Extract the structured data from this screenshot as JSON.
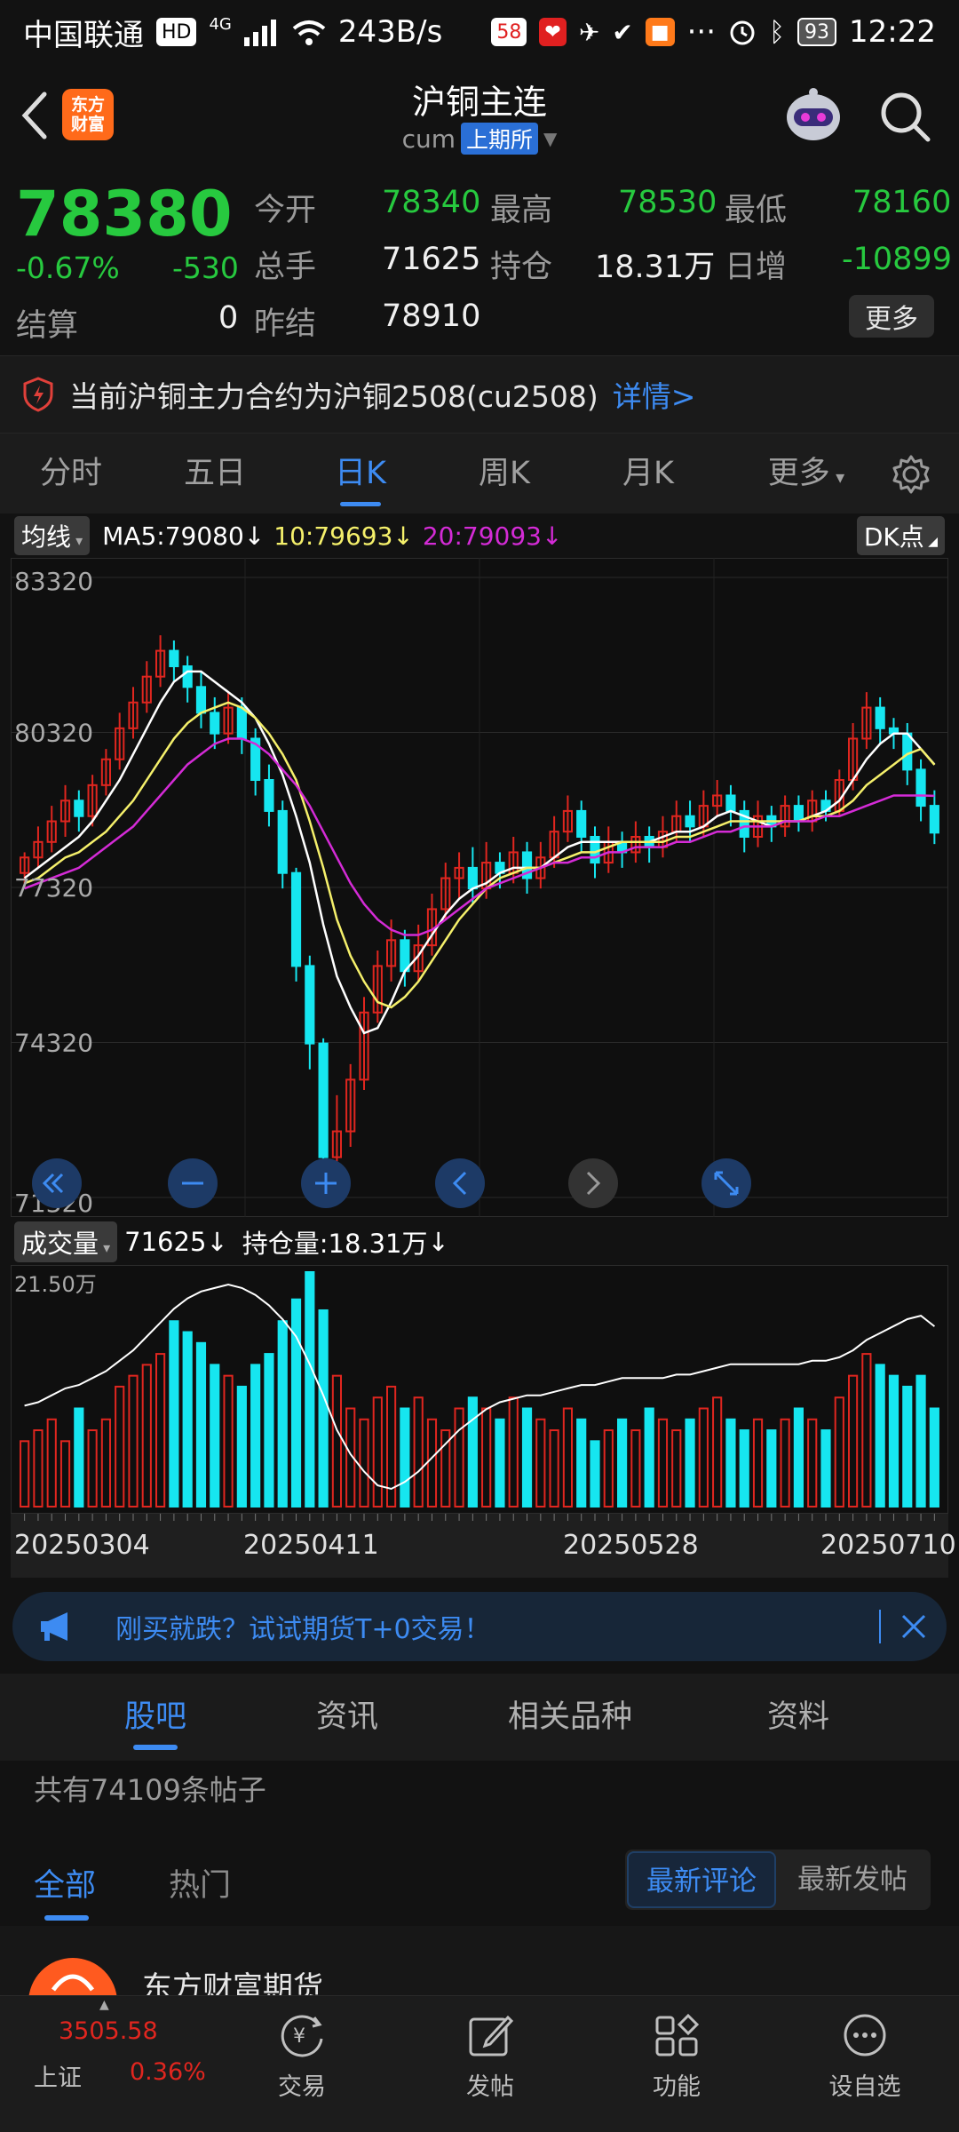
{
  "status_bar": {
    "carrier": "中国联通",
    "hd": "HD",
    "network": "4G",
    "speed": "243B/s",
    "app_badges": [
      "58"
    ],
    "battery": "93",
    "time": "12:22",
    "more": "···"
  },
  "header": {
    "logo_text": "东方\n财富",
    "title": "沪铜主连",
    "code": "cum",
    "exchange": "上期所"
  },
  "quote": {
    "price": "78380",
    "change_pct": "-0.67%",
    "change": "-530",
    "open_label": "今开",
    "open": "78340",
    "high_label": "最高",
    "high": "78530",
    "low_label": "最低",
    "low": "78160",
    "volume_label": "总手",
    "volume": "71625",
    "oi_label": "持仓",
    "oi": "18.31万",
    "daily_inc_label": "日增",
    "daily_inc": "-10899",
    "settle_label": "结算",
    "settle": "0",
    "prev_settle_label": "昨结",
    "prev_settle": "78910",
    "more_label": "更多"
  },
  "notice": {
    "text": "当前沪铜主力合约为沪铜2508(cu2508)",
    "link": "详情>"
  },
  "period_tabs": [
    "分时",
    "五日",
    "日K",
    "周K",
    "月K",
    "更多"
  ],
  "active_period": "日K",
  "ma_legend": {
    "selector": "均线",
    "ma5": "MA5:79080",
    "ma10": "10:79693",
    "ma20": "20:79093",
    "arrow": "↓",
    "dk": "DK点"
  },
  "colors": {
    "up": "#e0261f",
    "down": "#16e6f0",
    "ma5": "#ffffff",
    "ma10": "#f5f06b",
    "ma20": "#d42bd6",
    "accent": "#3d8bf2",
    "price_down": "#27c93f"
  },
  "volume_legend": {
    "selector": "成交量",
    "volume": "71625",
    "oi": "持仓量:18.31万",
    "arrow": "↓",
    "axis_max": "21.50万"
  },
  "chart_data": {
    "type": "candlestick",
    "ylim": [
      71320,
      83320
    ],
    "y_ticks": [
      "83320",
      "80320",
      "77320",
      "74320",
      "71320"
    ],
    "x_labels": [
      "20250304",
      "20250411",
      "20250528",
      "20250710"
    ],
    "candles": [
      [
        77600,
        77900,
        77300,
        78000
      ],
      [
        77900,
        78200,
        77700,
        78500
      ],
      [
        78200,
        78600,
        78000,
        78900
      ],
      [
        78600,
        79000,
        78300,
        79300
      ],
      [
        79000,
        78700,
        78400,
        79200
      ],
      [
        78700,
        79300,
        78500,
        79500
      ],
      [
        79300,
        79800,
        79100,
        80000
      ],
      [
        79800,
        80400,
        79600,
        80700
      ],
      [
        80400,
        80900,
        80200,
        81200
      ],
      [
        80900,
        81400,
        80700,
        81700
      ],
      [
        81400,
        81900,
        81200,
        82200
      ],
      [
        81900,
        81600,
        81300,
        82100
      ],
      [
        81600,
        81200,
        80900,
        81800
      ],
      [
        81200,
        80700,
        80400,
        81500
      ],
      [
        80700,
        80300,
        80000,
        81000
      ],
      [
        80300,
        80800,
        80100,
        81100
      ],
      [
        80800,
        80200,
        79900,
        81000
      ],
      [
        80200,
        79400,
        79100,
        80400
      ],
      [
        79400,
        78800,
        78500,
        79700
      ],
      [
        78800,
        77600,
        77300,
        79000
      ],
      [
        77600,
        75800,
        75500,
        77700
      ],
      [
        75800,
        74300,
        73800,
        76000
      ],
      [
        74300,
        72100,
        71400,
        74400
      ],
      [
        72100,
        72600,
        71500,
        73300
      ],
      [
        72600,
        73600,
        72300,
        73900
      ],
      [
        73600,
        74900,
        73400,
        75200
      ],
      [
        74900,
        75800,
        74700,
        76100
      ],
      [
        75800,
        76300,
        75500,
        76700
      ],
      [
        76300,
        75700,
        75400,
        76500
      ],
      [
        75700,
        76200,
        75500,
        76600
      ],
      [
        76200,
        76900,
        76000,
        77200
      ],
      [
        76900,
        77500,
        76700,
        77800
      ],
      [
        77500,
        77700,
        77100,
        78000
      ],
      [
        77700,
        77300,
        77000,
        78100
      ],
      [
        77300,
        77800,
        77100,
        78200
      ],
      [
        77800,
        77600,
        77300,
        78000
      ],
      [
        77600,
        78000,
        77400,
        78300
      ],
      [
        78000,
        77500,
        77200,
        78200
      ],
      [
        77500,
        77900,
        77300,
        78200
      ],
      [
        77900,
        78400,
        77700,
        78700
      ],
      [
        78400,
        78800,
        78200,
        79100
      ],
      [
        78800,
        78300,
        78000,
        79000
      ],
      [
        78300,
        77800,
        77500,
        78500
      ],
      [
        77800,
        78200,
        77600,
        78500
      ],
      [
        78200,
        78000,
        77700,
        78400
      ],
      [
        78000,
        78300,
        77800,
        78600
      ],
      [
        78300,
        78100,
        77800,
        78500
      ],
      [
        78100,
        78400,
        77900,
        78700
      ],
      [
        78400,
        78700,
        78200,
        79000
      ],
      [
        78700,
        78500,
        78200,
        79000
      ],
      [
        78500,
        78900,
        78300,
        79200
      ],
      [
        78900,
        79100,
        78700,
        79400
      ],
      [
        79100,
        78800,
        78500,
        79300
      ],
      [
        78800,
        78300,
        78000,
        79000
      ],
      [
        78300,
        78700,
        78100,
        79000
      ],
      [
        78700,
        78500,
        78200,
        78900
      ],
      [
        78500,
        78900,
        78300,
        79100
      ],
      [
        78900,
        78600,
        78400,
        79100
      ],
      [
        78600,
        79000,
        78400,
        79200
      ],
      [
        79000,
        78800,
        78600,
        79200
      ],
      [
        78800,
        79400,
        78700,
        79600
      ],
      [
        79400,
        80200,
        79200,
        80500
      ],
      [
        80200,
        80800,
        80000,
        81100
      ],
      [
        80800,
        80400,
        80100,
        81000
      ],
      [
        80400,
        80300,
        80000,
        80600
      ],
      [
        80300,
        79600,
        79300,
        80500
      ],
      [
        79600,
        78900,
        78600,
        79800
      ],
      [
        78900,
        78380,
        78160,
        79200
      ]
    ],
    "ma5": [
      77500,
      77700,
      77900,
      78100,
      78300,
      78600,
      79000,
      79400,
      79900,
      80400,
      80900,
      81300,
      81500,
      81500,
      81300,
      81100,
      80900,
      80600,
      80100,
      79500,
      78700,
      77800,
      76600,
      75600,
      75000,
      74500,
      74600,
      75100,
      75700,
      76000,
      76400,
      76800,
      77100,
      77300,
      77400,
      77600,
      77700,
      77700,
      77700,
      77900,
      78100,
      78200,
      78200,
      78200,
      78200,
      78200,
      78200,
      78300,
      78400,
      78400,
      78500,
      78700,
      78800,
      78700,
      78600,
      78500,
      78600,
      78600,
      78700,
      78800,
      79000,
      79400,
      79800,
      80100,
      80300,
      80300,
      80000,
      79700
    ],
    "ma10": [
      77400,
      77500,
      77700,
      77900,
      78000,
      78200,
      78400,
      78700,
      79000,
      79400,
      79800,
      80200,
      80500,
      80700,
      80800,
      80900,
      80800,
      80600,
      80300,
      79900,
      79400,
      78600,
      77700,
      76700,
      76000,
      75500,
      75100,
      75000,
      75200,
      75500,
      75900,
      76300,
      76700,
      77000,
      77300,
      77500,
      77600,
      77700,
      77700,
      77800,
      77900,
      78000,
      78000,
      78100,
      78200,
      78200,
      78200,
      78200,
      78300,
      78300,
      78400,
      78500,
      78600,
      78600,
      78600,
      78600,
      78600,
      78600,
      78700,
      78700,
      78800,
      79000,
      79300,
      79500,
      79700,
      79900,
      80000,
      79693
    ],
    "ma20": [
      77300,
      77400,
      77500,
      77600,
      77700,
      77900,
      78100,
      78300,
      78500,
      78800,
      79100,
      79400,
      79700,
      79900,
      80100,
      80200,
      80200,
      80100,
      79900,
      79600,
      79300,
      78900,
      78400,
      77900,
      77400,
      77000,
      76700,
      76500,
      76400,
      76400,
      76500,
      76700,
      76900,
      77100,
      77300,
      77400,
      77500,
      77600,
      77700,
      77800,
      77800,
      77900,
      77900,
      78000,
      78000,
      78100,
      78100,
      78100,
      78200,
      78200,
      78300,
      78400,
      78400,
      78500,
      78500,
      78500,
      78600,
      78600,
      78600,
      78700,
      78700,
      78800,
      78900,
      79000,
      79100,
      79100,
      79100,
      79093
    ],
    "volumes": [
      6,
      7,
      8,
      6,
      9,
      7,
      8,
      11,
      12,
      13,
      14,
      17,
      16,
      15,
      13,
      12,
      11,
      13,
      14,
      17,
      19,
      21.5,
      18,
      12,
      9,
      8,
      10,
      11,
      9,
      10,
      8,
      7,
      9,
      10,
      9,
      8,
      10,
      9,
      8,
      7,
      9,
      8,
      6,
      7,
      8,
      7,
      9,
      8,
      7,
      8,
      9,
      10,
      8,
      7,
      8,
      7,
      8,
      9,
      8,
      7,
      10,
      12,
      14,
      13,
      12,
      11,
      12,
      9
    ],
    "vol_max": 21.5
  },
  "toolbar_icons": [
    "first-icon",
    "zoom-out-icon",
    "zoom-in-icon",
    "prev-icon",
    "next-icon",
    "fullscreen-icon"
  ],
  "promo": {
    "text": "刚买就跌？试试期货T+0交易！"
  },
  "community_tabs": [
    "股吧",
    "资讯",
    "相关品种",
    "资料"
  ],
  "active_community_tab": "股吧",
  "post_count": "共有74109条帖子",
  "filters": {
    "all": "全部",
    "hot": "热门",
    "latest_comment": "最新评论",
    "latest_post": "最新发帖"
  },
  "feed_preview": {
    "name": "东方财富期货"
  },
  "bottom_nav": {
    "index_value": "3505.58",
    "index_name": "上证",
    "index_change": "0.36%",
    "trade": "交易",
    "post": "发帖",
    "function": "功能",
    "add_watch": "设自选"
  }
}
